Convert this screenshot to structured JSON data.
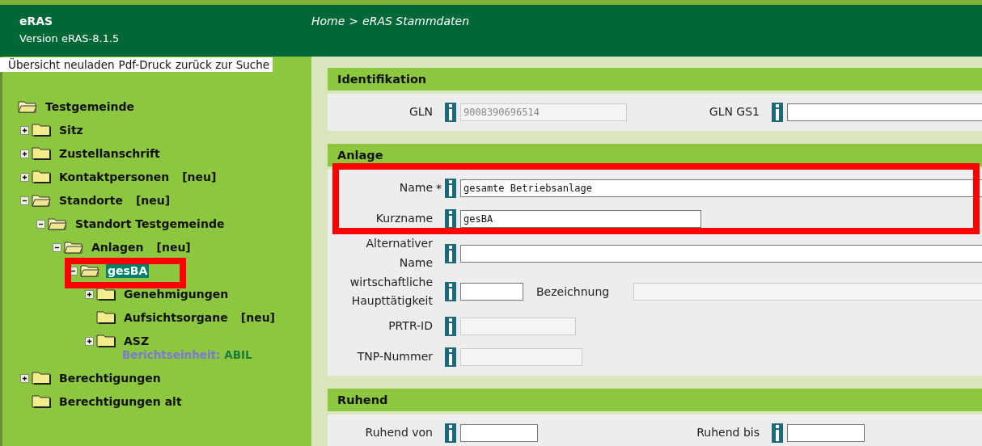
{
  "header": {
    "app_name": "eRAS",
    "version": "Version eRAS-8.1.5",
    "breadcrumb": [
      "Home",
      "eRAS Stammdaten"
    ],
    "breadcrumb_separator": ">"
  },
  "toolbar": [
    "Übersicht neuladen",
    "Pdf-Druck",
    "zurück zur Suche"
  ],
  "tree": {
    "label": "Testgemeinde",
    "selected": false,
    "children": [
      {
        "label": "Sitz",
        "expanded": false,
        "selected": false
      },
      {
        "label": "Zustellanschrift",
        "expanded": false,
        "selected": false
      },
      {
        "label": "Kontaktpersonen",
        "badge": "[neu]",
        "expanded": false,
        "selected": false
      },
      {
        "label": "Standorte",
        "badge": "[neu]",
        "expanded": true,
        "selected": false,
        "children": [
          {
            "label": "Standort Testgemeinde",
            "expanded": true,
            "selected": false,
            "children": [
              {
                "label": "Anlagen",
                "badge": "[neu]",
                "expanded": true,
                "selected": false,
                "children": [
                  {
                    "label": "gesBA",
                    "expanded": true,
                    "selected": true,
                    "children": [
                      {
                        "label": "Genehmigungen",
                        "expanded": false,
                        "selected": false
                      },
                      {
                        "label": "Aufsichtsorgane",
                        "badge": "[neu]",
                        "selected": false
                      },
                      {
                        "label": "ASZ",
                        "expanded": false,
                        "selected": false,
                        "subtitle_label": "Berichtseinheit:",
                        "subtitle_value": "ABIL"
                      }
                    ]
                  }
                ]
              }
            ]
          }
        ]
      },
      {
        "label": "Berechtigungen",
        "expanded": false,
        "selected": false
      },
      {
        "label": "Berechtigungen alt",
        "selected": false
      }
    ]
  },
  "sections": [
    {
      "title": "Identifikation",
      "rows": [
        {
          "kind": "pair",
          "cells": [
            {
              "label": "GLN",
              "field": {
                "value": "9008390696514",
                "disabled": true
              }
            },
            {
              "label": "GLN GS1",
              "field": {
                "disabled": false
              }
            }
          ]
        }
      ]
    },
    {
      "title": "Anlage",
      "rows": [
        {
          "kind": "single",
          "cells": [
            {
              "label": "Name",
              "required_mark": "*",
              "field": {
                "value": "gesamte Betriebsanlage",
                "disabled": false
              }
            }
          ]
        },
        {
          "kind": "single",
          "cells": [
            {
              "label": "Kurzname",
              "field": {
                "value": "gesBA",
                "disabled": false
              }
            }
          ]
        },
        {
          "kind": "single",
          "cells": [
            {
              "label": "Alternativer Name",
              "field": {
                "disabled": false
              }
            }
          ]
        },
        {
          "kind": "with_description",
          "cells": [
            {
              "label": "wirtschaftliche Haupttätigkeit",
              "field": {
                "disabled": false
              },
              "description_label": "Bezeichnung",
              "description_field": {
                "disabled": true
              }
            }
          ]
        },
        {
          "kind": "single",
          "cells": [
            {
              "label": "PRTR-ID",
              "field": {
                "disabled": true
              }
            }
          ]
        },
        {
          "kind": "single",
          "cells": [
            {
              "label": "TNP-Nummer",
              "field": {
                "disabled": true
              }
            }
          ]
        }
      ]
    },
    {
      "title": "Ruhend",
      "rows": [
        {
          "kind": "pair",
          "cells": [
            {
              "label": "Ruhend von",
              "field": {
                "disabled": false
              }
            },
            {
              "label": "Ruhend bis",
              "field": {
                "disabled": false
              }
            }
          ]
        }
      ]
    }
  ]
}
